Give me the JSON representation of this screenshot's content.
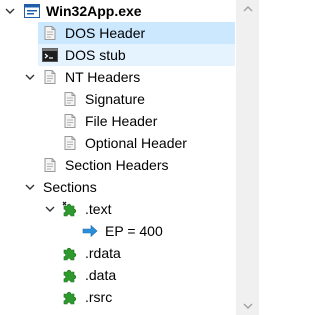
{
  "tree": {
    "root": {
      "label": "Win32App.exe",
      "icon": "exe-window-icon"
    },
    "dos_header": {
      "label": "DOS Header",
      "icon": "document-icon"
    },
    "dos_stub": {
      "label": "DOS stub",
      "icon": "console-icon"
    },
    "nt_headers": {
      "label": "NT Headers",
      "icon": "document-icon"
    },
    "signature": {
      "label": "Signature",
      "icon": "document-icon"
    },
    "file_header": {
      "label": "File Header",
      "icon": "document-icon"
    },
    "optional_header": {
      "label": "Optional Header",
      "icon": "document-icon"
    },
    "section_headers": {
      "label": "Section Headers",
      "icon": "document-icon"
    },
    "sections": {
      "label": "Sections"
    },
    "text": {
      "label": ".text",
      "icon": "puzzle-icon"
    },
    "entry_point": {
      "label": "EP = 400",
      "icon": "arrow-right-icon"
    },
    "rdata": {
      "label": ".rdata",
      "icon": "puzzle-icon"
    },
    "data": {
      "label": ".data",
      "icon": "puzzle-icon"
    },
    "rsrc": {
      "label": ".rsrc",
      "icon": "puzzle-icon"
    }
  },
  "colors": {
    "selected_bg": "#cce8ff",
    "hover_bg": "#e5f3ff",
    "puzzle_green": "#2e9a2e",
    "ep_arrow": "#2b8fd9",
    "scrollbar_bg": "#f0f0f0"
  }
}
